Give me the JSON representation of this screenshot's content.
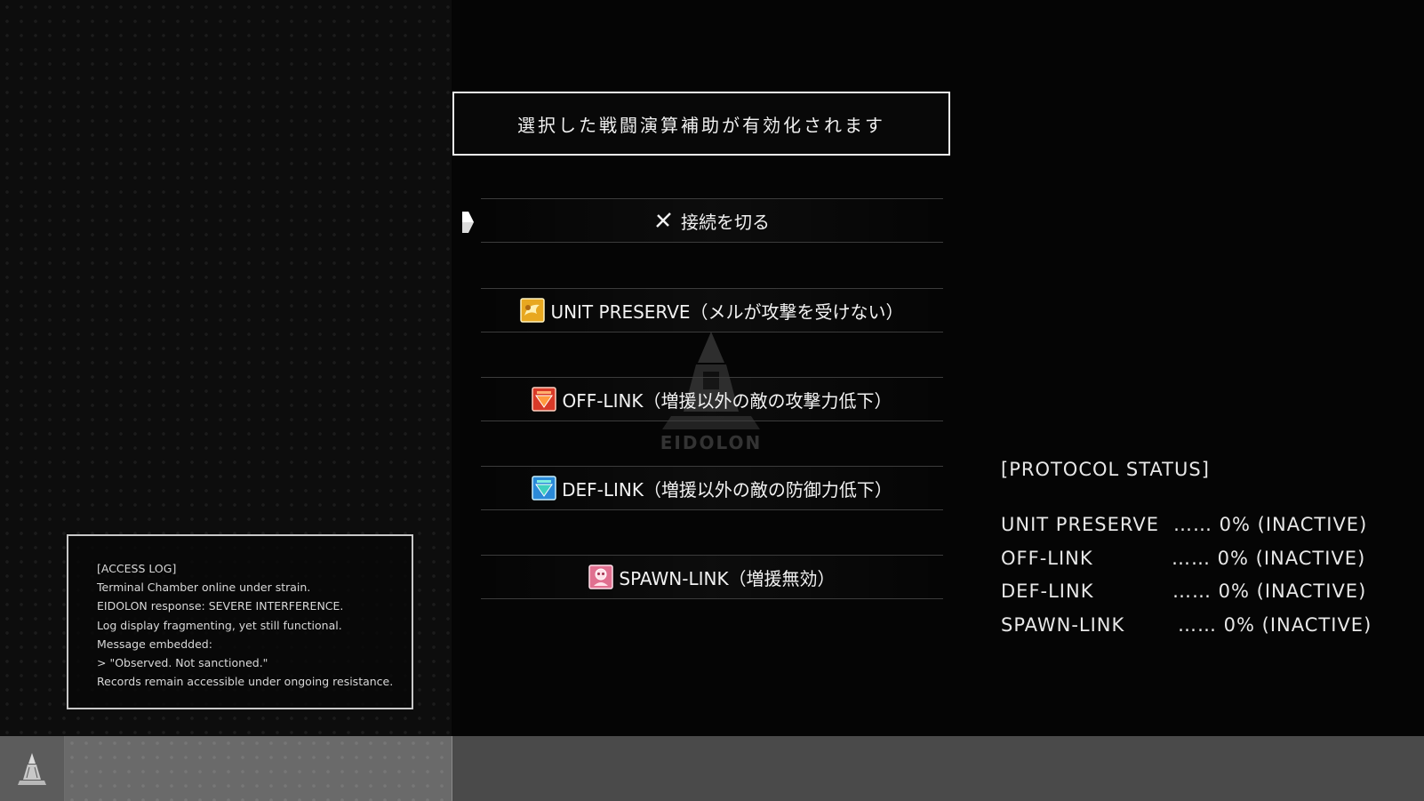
{
  "header": {
    "message": "選択した戦闘演算補助が有効化されます"
  },
  "menu": {
    "items": [
      {
        "label": "接続を切る",
        "icon": "disconnect-icon"
      },
      {
        "label": "UNIT PRESERVE（メルが攻撃を受けない）",
        "icon": "unit-preserve-icon"
      },
      {
        "label": "OFF-LINK（増援以外の敵の攻撃力低下）",
        "icon": "attack-down-icon"
      },
      {
        "label": "DEF-LINK（増援以外の敵の防御力低下）",
        "icon": "defense-down-icon"
      },
      {
        "label": "SPAWN-LINK（増援無効）",
        "icon": "spawn-block-icon"
      }
    ],
    "selected_index": 0
  },
  "watermark": {
    "text": "EIDOLON"
  },
  "access_log": {
    "lines": [
      "[ACCESS LOG]",
      "Terminal Chamber online under strain.",
      "EIDOLON response: SEVERE INTERFERENCE.",
      "Log display fragmenting, yet still functional.",
      "Message embedded:",
      "> \"Observed. Not sanctioned.\"",
      "Records remain accessible under ongoing resistance."
    ]
  },
  "protocol_status": {
    "title": "[PROTOCOL STATUS]",
    "rows": [
      {
        "name": "UNIT PRESERVE",
        "value": "…… 0% (INACTIVE)"
      },
      {
        "name": "OFF-LINK",
        "value": "…… 0% (INACTIVE)"
      },
      {
        "name": "DEF-LINK",
        "value": "…… 0% (INACTIVE)"
      },
      {
        "name": "SPAWN-LINK",
        "value": "…… 0% (INACTIVE)"
      }
    ]
  },
  "colors": {
    "background": "#080808",
    "text": "#e8e8e8",
    "bottom_bar": "#4a4a4a",
    "icon_gold": "#e8a820",
    "icon_red": "#d83a28",
    "icon_blue": "#2a8ad8",
    "icon_pink": "#e07090"
  }
}
